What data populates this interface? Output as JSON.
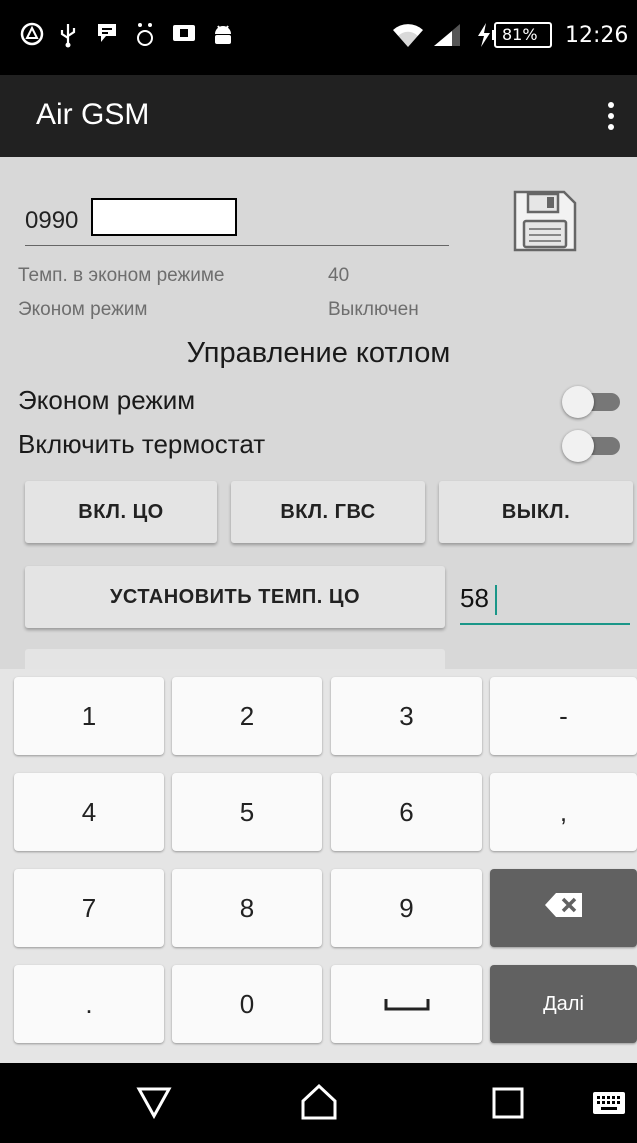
{
  "status_bar": {
    "battery": "81%",
    "time": "12:26",
    "icons": [
      "warning-circle-icon",
      "usb-icon",
      "notification-icon",
      "bug-icon",
      "sim-icon",
      "android-icon",
      "wifi-icon",
      "cell-signal-icon",
      "charging-icon",
      "battery-icon"
    ]
  },
  "app": {
    "title": "Air GSM",
    "menu_icon": "more-vertical-icon"
  },
  "phone_field": {
    "value": "0990"
  },
  "info": {
    "row1": {
      "label": "Темп. в эконом режиме",
      "value": "40"
    },
    "row2": {
      "label": "Эконом режим",
      "value": "Выключен"
    }
  },
  "section_title": "Управление котлом",
  "switches": [
    {
      "label": "Эконом режим",
      "on": false
    },
    {
      "label": "Включить термостат",
      "on": false
    }
  ],
  "buttons": {
    "heating_on": "ВКЛ. ЦО",
    "hot_water_on": "ВКЛ. ГВС",
    "off": "ВЫКЛ.",
    "set_temp": "УСТАНОВИТЬ ТЕМП. ЦО"
  },
  "temp_input": {
    "value": "58"
  },
  "keyboard": {
    "row1": [
      "1",
      "2",
      "3",
      "-"
    ],
    "row2": [
      "4",
      "5",
      "6",
      ","
    ],
    "row3": [
      "7",
      "8",
      "9"
    ],
    "row4": [
      ".",
      "0"
    ],
    "next_label": "Далі"
  },
  "colors": {
    "accent": "#1a9688",
    "toolbar": "#212121",
    "content_bg": "#d8d8d8"
  }
}
